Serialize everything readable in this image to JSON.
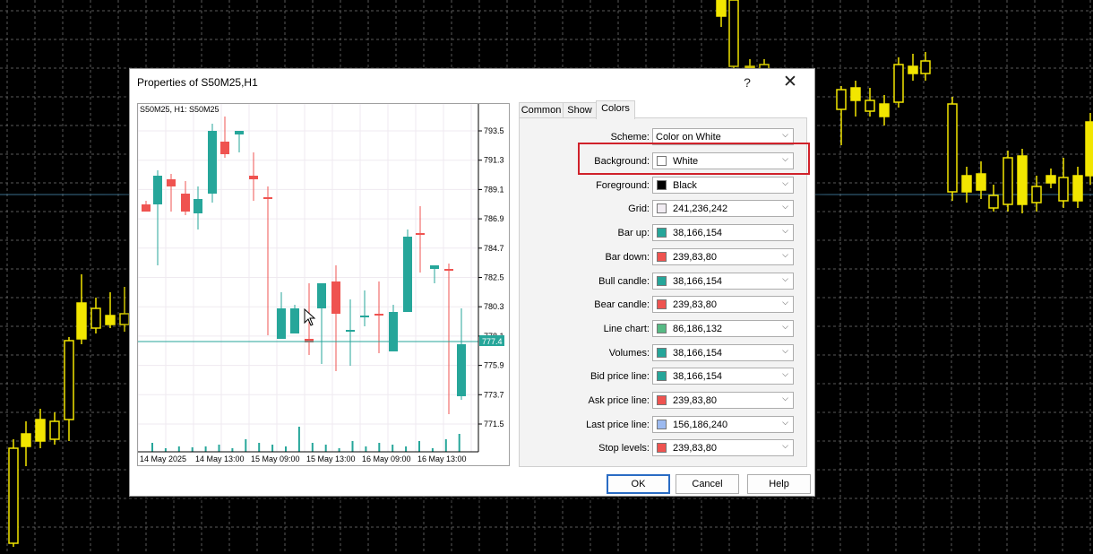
{
  "dialog": {
    "title": "Properties of S50M25,H1",
    "help_glyph": "?",
    "close_glyph": "✕"
  },
  "preview": {
    "label": "S50M25, H1:  S50M25",
    "current_price": "777.4",
    "price_labels": [
      "793.5",
      "791.3",
      "789.1",
      "786.9",
      "784.7",
      "782.5",
      "780.3",
      "778.1",
      "775.9",
      "773.7",
      "771.5"
    ],
    "time_labels": [
      "14 May 2025",
      "14 May 13:00",
      "15 May 09:00",
      "15 May 13:00",
      "16 May 09:00",
      "16 May 13:00"
    ]
  },
  "tabs": [
    {
      "label": "Common",
      "active": false
    },
    {
      "label": "Show",
      "active": false
    },
    {
      "label": "Colors",
      "active": true
    }
  ],
  "colors": {
    "scheme": {
      "label": "Scheme:",
      "value": "Color on White"
    },
    "rows": [
      {
        "label": "Background:",
        "value": "White",
        "swatch": "#ffffff"
      },
      {
        "label": "Foreground:",
        "value": "Black",
        "swatch": "#000000"
      },
      {
        "label": "Grid:",
        "value": "241,236,242",
        "swatch": "#f1ecf2"
      },
      {
        "label": "Bar up:",
        "value": "38,166,154",
        "swatch": "#26a69a"
      },
      {
        "label": "Bar down:",
        "value": "239,83,80",
        "swatch": "#ef5350"
      },
      {
        "label": "Bull candle:",
        "value": "38,166,154",
        "swatch": "#26a69a"
      },
      {
        "label": "Bear candle:",
        "value": "239,83,80",
        "swatch": "#ef5350"
      },
      {
        "label": "Line chart:",
        "value": "86,186,132",
        "swatch": "#56ba84"
      },
      {
        "label": "Volumes:",
        "value": "38,166,154",
        "swatch": "#26a69a"
      },
      {
        "label": "Bid price line:",
        "value": "38,166,154",
        "swatch": "#26a69a"
      },
      {
        "label": "Ask price line:",
        "value": "239,83,80",
        "swatch": "#ef5350"
      },
      {
        "label": "Last price line:",
        "value": "156,186,240",
        "swatch": "#9cbaf0"
      },
      {
        "label": "Stop levels:",
        "value": "239,83,80",
        "swatch": "#ef5350"
      }
    ]
  },
  "buttons": {
    "ok": "OK",
    "cancel": "Cancel",
    "help": "Help"
  },
  "style": {
    "bull": "#26a69a",
    "bear": "#ef5350",
    "bg_bull": "#ffffff",
    "bg_bear": "#f2e600",
    "bg_grid": "#5a5a5a",
    "highlight": "#d0212a"
  }
}
